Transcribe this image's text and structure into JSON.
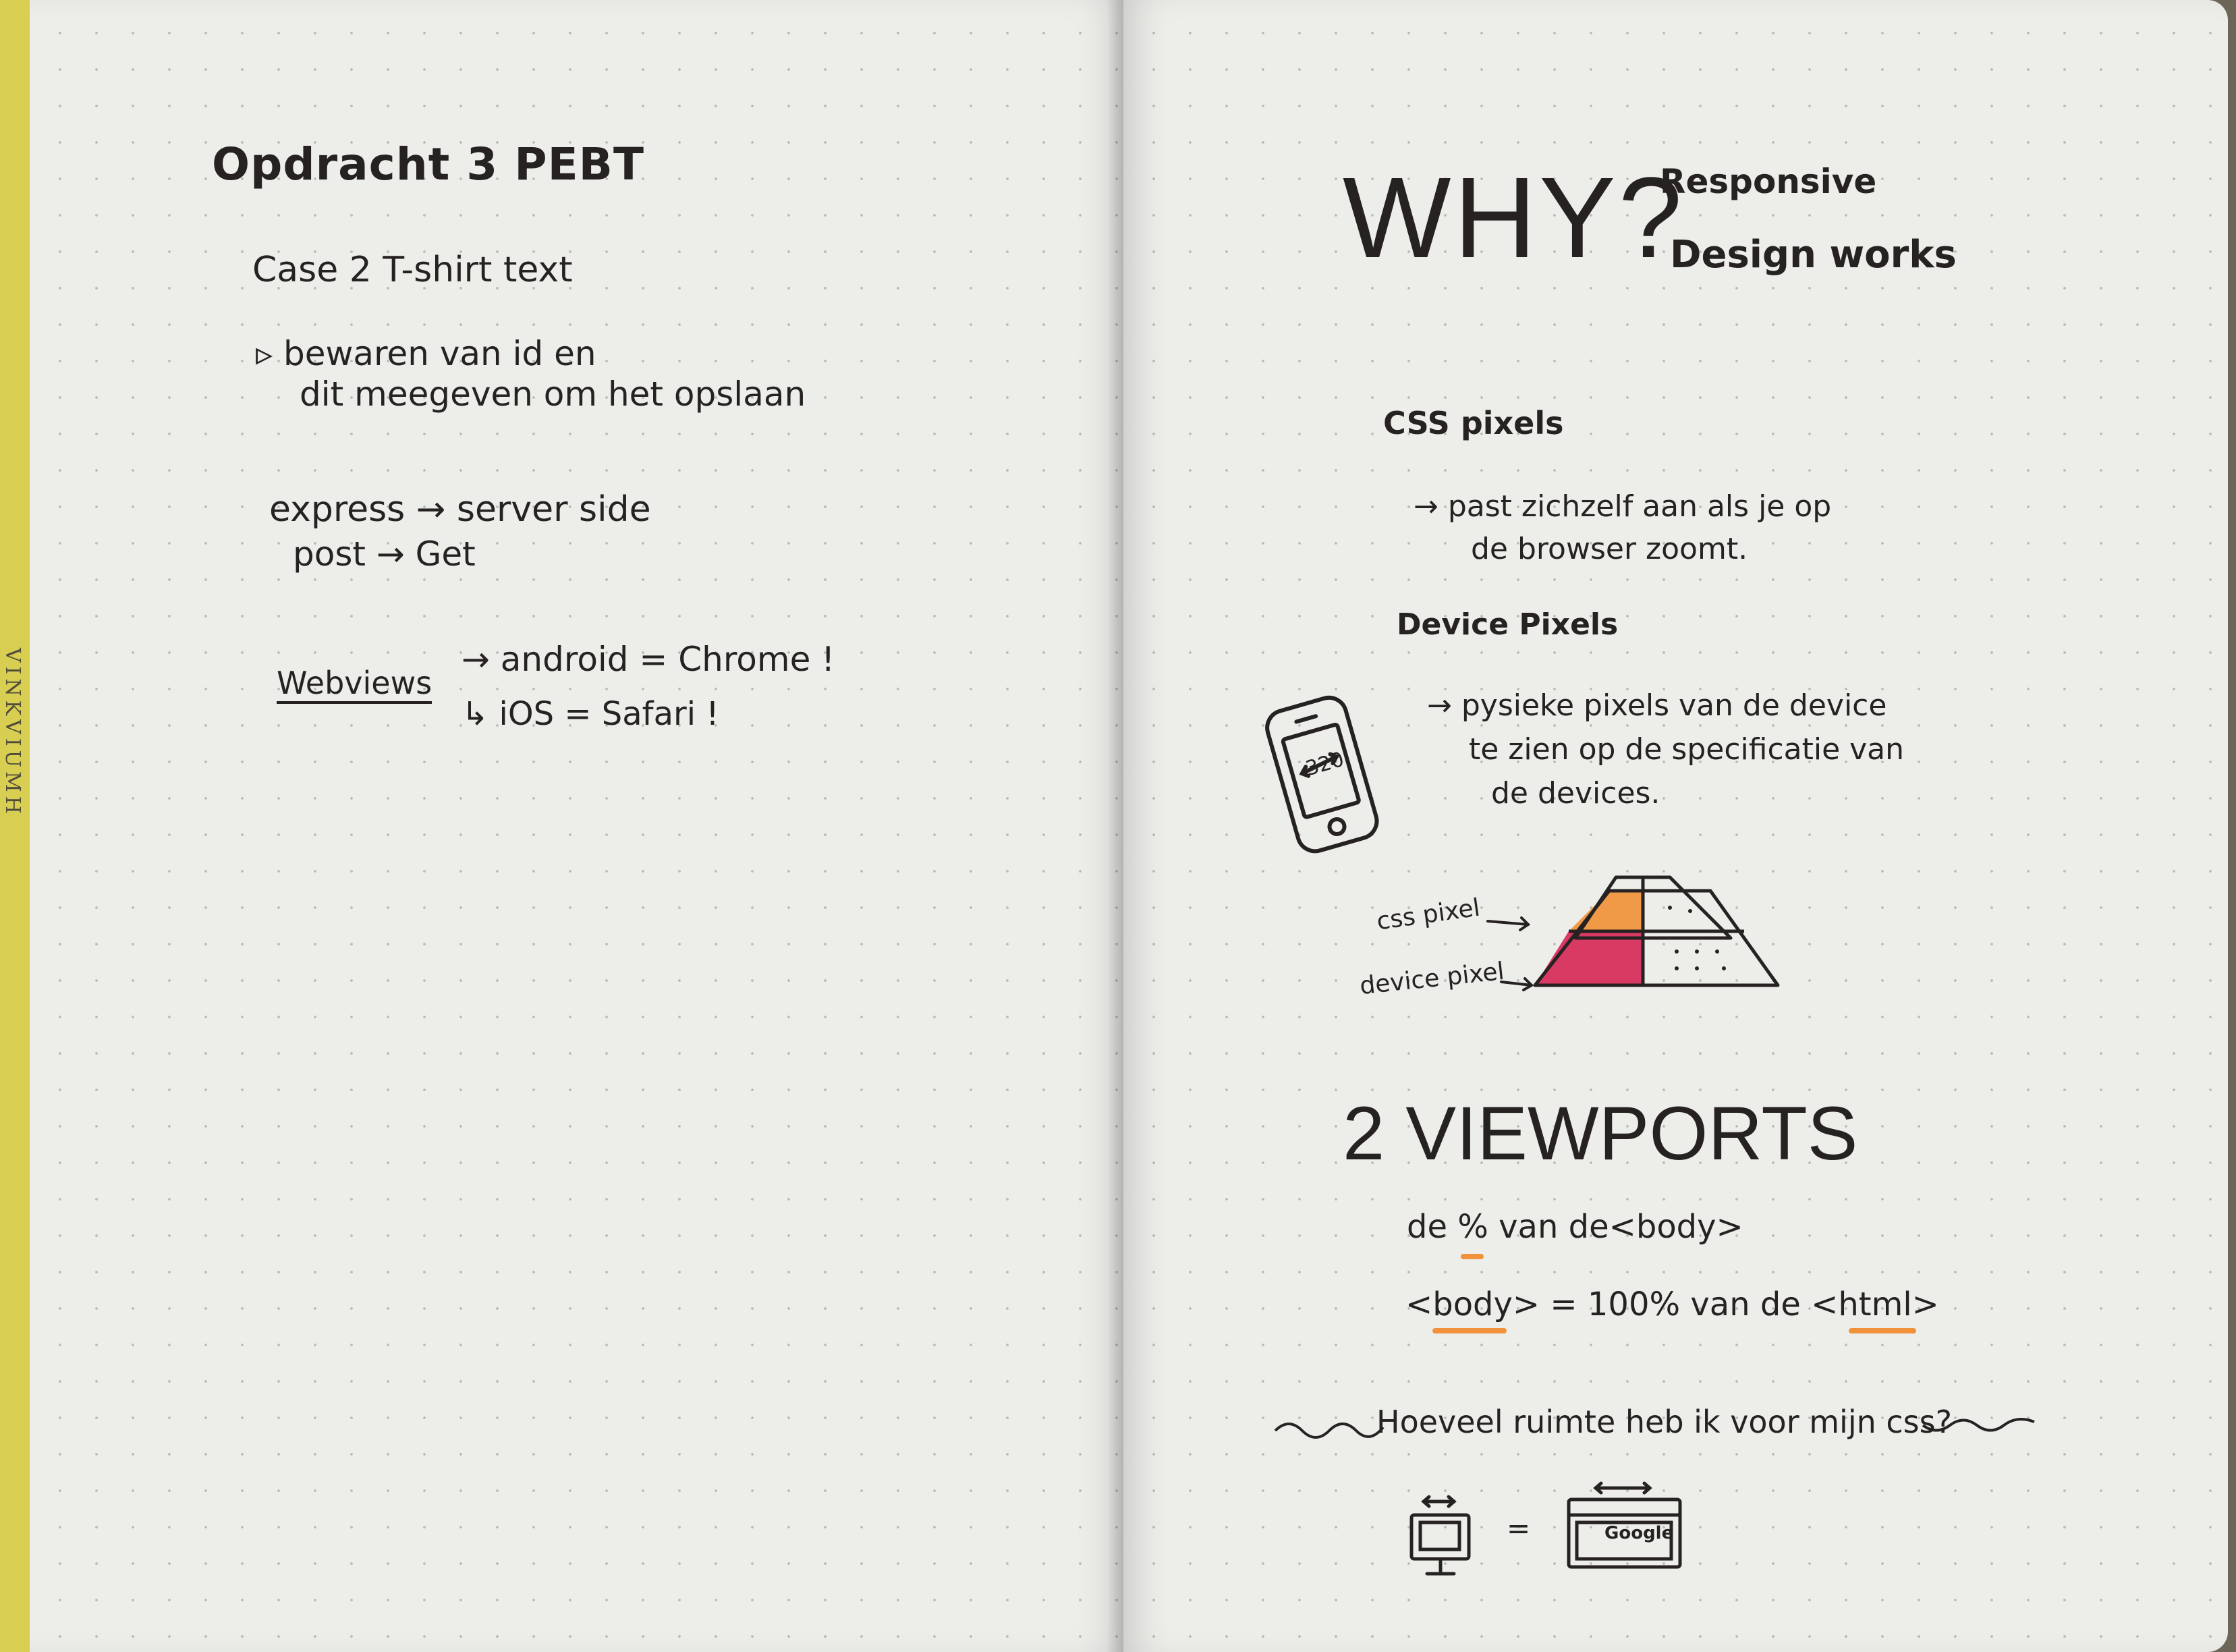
{
  "left_page": {
    "title": "Opdracht 3 PEBT",
    "case": "Case 2 T-shirt text",
    "bullet_line1": "▹ bewaren van id en",
    "bullet_line2": "dit meegeven om het opslaan",
    "express_line": "express → server side",
    "post_line": "post → Get",
    "webviews_label": "Webviews",
    "android_line": "→ android = Chrome !",
    "ios_line": "↳ iOS = Safari !"
  },
  "right_page": {
    "why": "WHY?",
    "subtitle_line1": "Responsive",
    "subtitle_line2": "Design works",
    "css_pixels_heading": "CSS pixels",
    "css_pixels_note1": "→ past zichzelf aan als je op",
    "css_pixels_note2": "de browser zoomt.",
    "device_pixels_heading": "Device Pixels",
    "device_pixels_note1": "→ pysieke pixels van de device",
    "device_pixels_note2": "te zien op de specificatie van",
    "device_pixels_note3": "de devices.",
    "phone_number": "320",
    "css_pixel_label": "css pixel",
    "device_pixel_label": "device pixel",
    "viewports_heading": "2 VIEWPORTS",
    "percent_line": "de % van de<body>",
    "body_line": "<body> = 100% van de <html>",
    "question": "Hoeveel ruimte heb ik voor mijn css?",
    "equals": "=",
    "browser_label": "Google"
  },
  "colors": {
    "ink": "#262222",
    "highlight_orange": "#f0923a",
    "highlight_pink": "#d93a64",
    "page": "#edeeea",
    "spine": "#d8cf52"
  }
}
